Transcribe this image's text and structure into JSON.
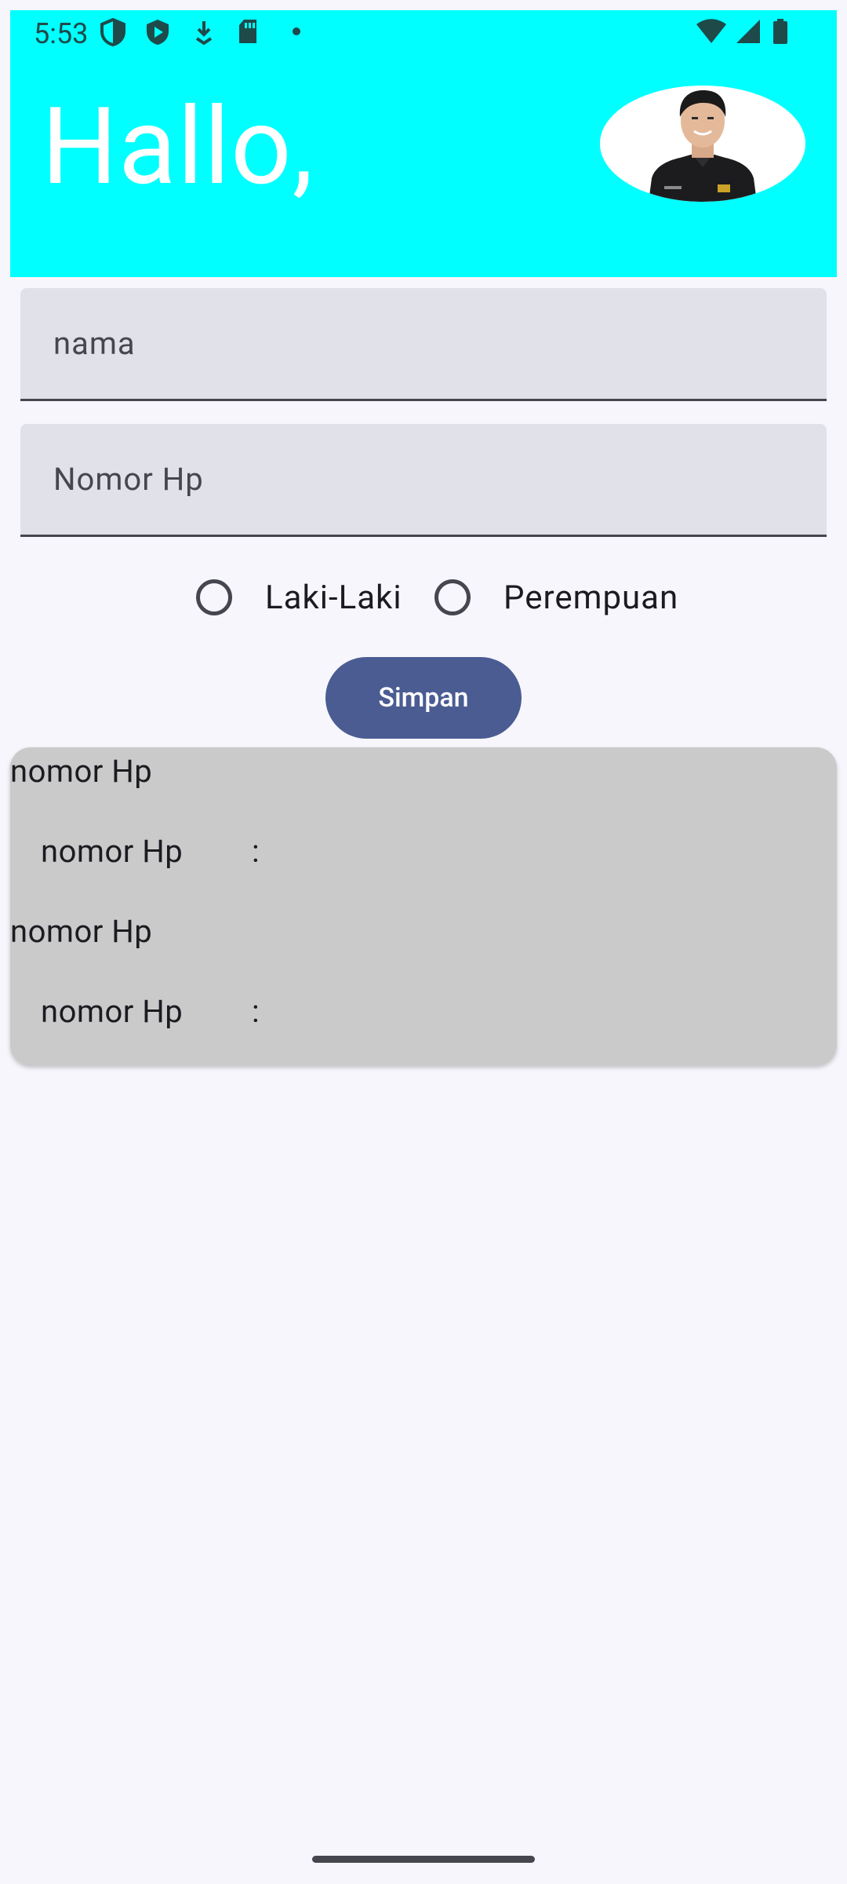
{
  "status_bar": {
    "time": "5:53",
    "left_icons": [
      "shield-icon",
      "play-protect-icon",
      "download-icon",
      "sd-card-icon",
      "dot-icon"
    ],
    "right_icons": [
      "wifi-icon",
      "signal-icon",
      "battery-icon"
    ]
  },
  "header": {
    "greeting": "Hallo,",
    "background_color": "#00ffff"
  },
  "form": {
    "name_placeholder": "nama",
    "phone_placeholder": "Nomor Hp",
    "gender_options": [
      "Laki-Laki",
      "Perempuan"
    ],
    "save_label": "Simpan",
    "button_color": "#4a5c92"
  },
  "results": {
    "rows": [
      {
        "heading": "nomor Hp",
        "label": "nomor Hp",
        "separator": ":"
      },
      {
        "heading": "nomor Hp",
        "label": "nomor Hp",
        "separator": ":"
      }
    ]
  }
}
